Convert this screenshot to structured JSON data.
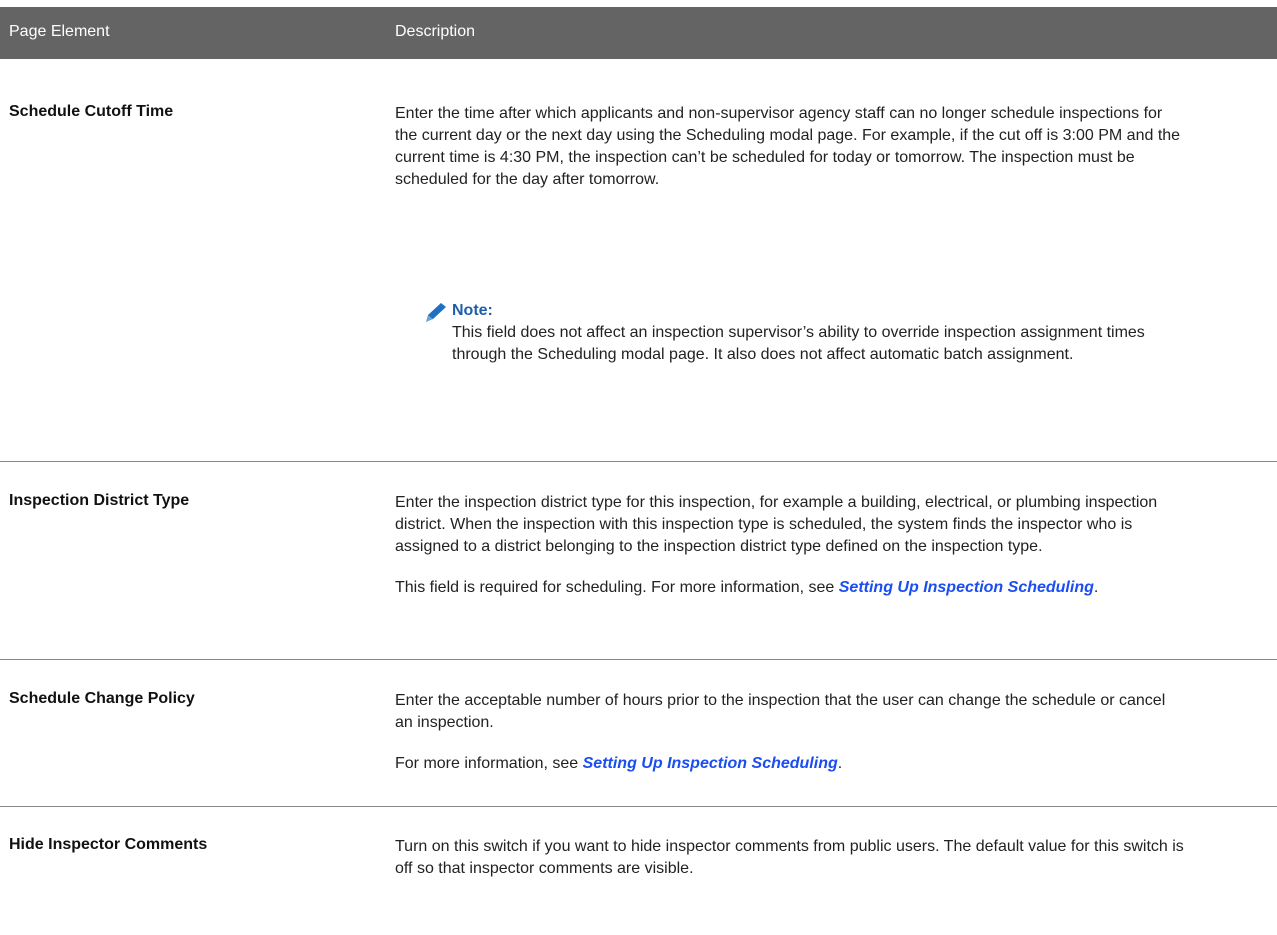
{
  "header": {
    "col_element": "Page Element",
    "col_description": "Description"
  },
  "rows": [
    {
      "label": "Schedule Cutoff Time",
      "paragraphs": [
        "Enter the time after which applicants and non-supervisor agency staff can no longer schedule inspections for the current day or the next day using the Scheduling modal page. For example, if the cut off is 3:00 PM and the current time is 4:30 PM, the inspection can’t be scheduled for today or tomorrow. The inspection must be scheduled for the day after tomorrow."
      ],
      "note": {
        "title": "Note:",
        "body": "This field does not affect an inspection supervisor’s ability to override inspection assignment times through the Scheduling modal page. It also does not affect automatic batch assignment.",
        "icon": "pencil-icon",
        "icon_color": "#1f6fc4"
      }
    },
    {
      "label": "Inspection District Type",
      "paragraphs": [
        "Enter the inspection district type for this inspection, for example a building, electrical, or plumbing inspection district. When the inspection with this inspection type is scheduled, the system finds the inspector who is assigned to a district belonging to the inspection district type defined on the inspection type."
      ],
      "link_paragraph": {
        "before": "This field is required for scheduling. For more information, see ",
        "link": "Setting Up Inspection Scheduling",
        "after": "."
      }
    },
    {
      "label": "Schedule Change Policy",
      "paragraphs": [
        "Enter the acceptable number of hours prior to the inspection that the user can change the schedule or cancel an inspection."
      ],
      "link_paragraph": {
        "before": "For more information, see ",
        "link": "Setting Up Inspection Scheduling",
        "after": "."
      }
    },
    {
      "label": "Hide Inspector Comments",
      "paragraphs": [
        "Turn on this switch if you want to hide inspector comments from public users. The default value for this switch is off so that inspector comments are visible."
      ]
    }
  ],
  "colors": {
    "header_bg": "#646464",
    "link": "#1a4df2",
    "note_title": "#1f5eaa"
  }
}
